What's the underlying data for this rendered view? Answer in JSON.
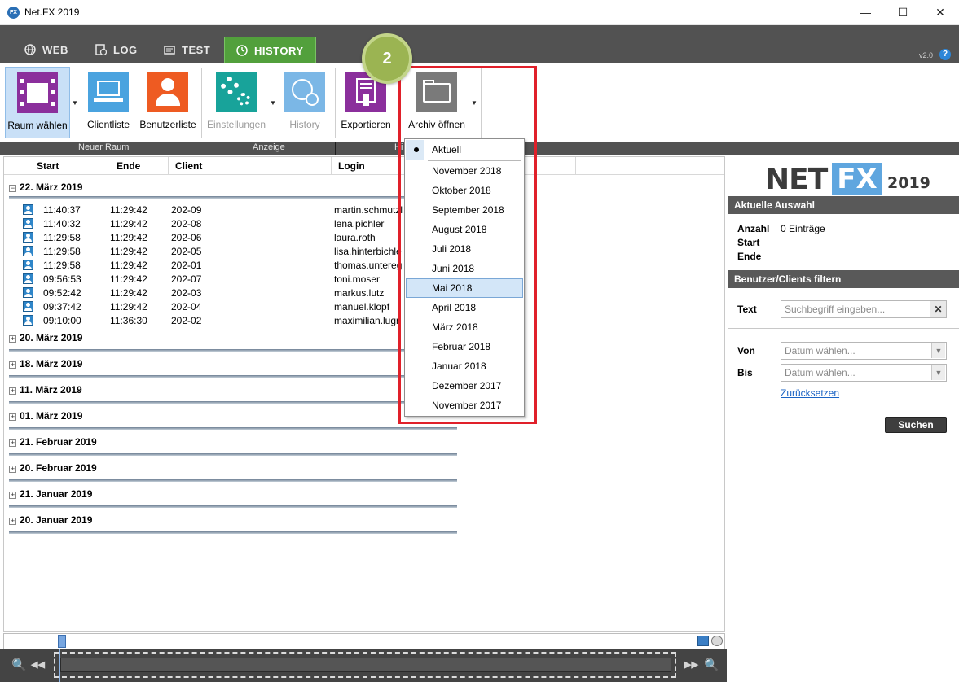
{
  "window": {
    "title": "Net.FX 2019",
    "app_icon": "FX",
    "minimize": "—",
    "maximize": "☐",
    "close": "✕"
  },
  "tabs": [
    {
      "label": "WEB",
      "icon": "globe-icon"
    },
    {
      "label": "LOG",
      "icon": "log-icon"
    },
    {
      "label": "TEST",
      "icon": "test-icon"
    },
    {
      "label": "HISTORY",
      "icon": "history-icon",
      "active": true
    }
  ],
  "version": "v2.0",
  "help": "?",
  "ribbon": {
    "buttons": {
      "raum_waehlen": "Raum wählen",
      "clientliste": "Clientliste",
      "benutzerliste": "Benutzerliste",
      "einstellungen": "Einstellungen",
      "history": "History",
      "exportieren": "Exportieren",
      "archiv_oeffnen": "Archiv öffnen"
    },
    "groups": {
      "neuer_raum": "Neuer Raum",
      "anzeige": "Anzeige",
      "truncated": "Hi"
    }
  },
  "badge": "2",
  "table": {
    "headers": {
      "start": "Start",
      "ende": "Ende",
      "client": "Client",
      "login": "Login"
    },
    "groups": [
      {
        "label": "22. März 2019",
        "toggle": "−",
        "expanded": true
      },
      {
        "label": "20. März 2019",
        "toggle": "+"
      },
      {
        "label": "18. März 2019",
        "toggle": "+"
      },
      {
        "label": "11. März 2019",
        "toggle": "+"
      },
      {
        "label": "01. März 2019",
        "toggle": "+"
      },
      {
        "label": "21. Februar 2019",
        "toggle": "+"
      },
      {
        "label": "20. Februar 2019",
        "toggle": "+"
      },
      {
        "label": "21. Januar 2019",
        "toggle": "+"
      },
      {
        "label": "20. Januar 2019",
        "toggle": "+"
      }
    ],
    "rows": [
      {
        "start": "11:40:37",
        "ende": "11:29:42",
        "client": "202-09",
        "login": "martin.schmutzl"
      },
      {
        "start": "11:40:32",
        "ende": "11:29:42",
        "client": "202-08",
        "login": "lena.pichler"
      },
      {
        "start": "11:29:58",
        "ende": "11:29:42",
        "client": "202-06",
        "login": "laura.roth"
      },
      {
        "start": "11:29:58",
        "ende": "11:29:42",
        "client": "202-05",
        "login": "lisa.hinterbichle"
      },
      {
        "start": "11:29:58",
        "ende": "11:29:42",
        "client": "202-01",
        "login": "thomas.untereg"
      },
      {
        "start": "09:56:53",
        "ende": "11:29:42",
        "client": "202-07",
        "login": "toni.moser"
      },
      {
        "start": "09:52:42",
        "ende": "11:29:42",
        "client": "202-03",
        "login": "markus.lutz"
      },
      {
        "start": "09:37:42",
        "ende": "11:29:42",
        "client": "202-04",
        "login": "manuel.klopf"
      },
      {
        "start": "09:10:00",
        "ende": "11:36:30",
        "client": "202-02",
        "login": "maximilian.lugn"
      }
    ]
  },
  "dropdown": {
    "current": "Aktuell",
    "items": [
      "November 2018",
      "Oktober 2018",
      "September 2018",
      "August 2018",
      "Juli 2018",
      "Juni 2018",
      "Mai 2018",
      "April 2018",
      "März 2018",
      "Februar 2018",
      "Januar 2018",
      "Dezember 2017",
      "November 2017"
    ],
    "highlighted": "Mai 2018"
  },
  "right_panel": {
    "logo": {
      "net": "NET",
      "fx": "FX",
      "year": "2019"
    },
    "aktuelle_auswahl": {
      "header": "Aktuelle Auswahl",
      "anzahl_label": "Anzahl",
      "anzahl_value": "0 Einträge",
      "start_label": "Start",
      "ende_label": "Ende"
    },
    "filter": {
      "header": "Benutzer/Clients filtern",
      "text_label": "Text",
      "text_placeholder": "Suchbegriff eingeben...",
      "clear": "✕",
      "von_label": "Von",
      "bis_label": "Bis",
      "date_placeholder": "Datum wählen...",
      "reset_link": "Zurücksetzen",
      "search_button": "Suchen"
    }
  },
  "timeline": {
    "zoom_out": "🔍",
    "rewind": "◀◀",
    "forward": "▶▶",
    "zoom_in": "🔍"
  },
  "colors": {
    "tab_active": "#52a03c",
    "accent_blue": "#2d86d8",
    "highlight_red": "#e0202a",
    "badge_green": "#9bb452"
  }
}
